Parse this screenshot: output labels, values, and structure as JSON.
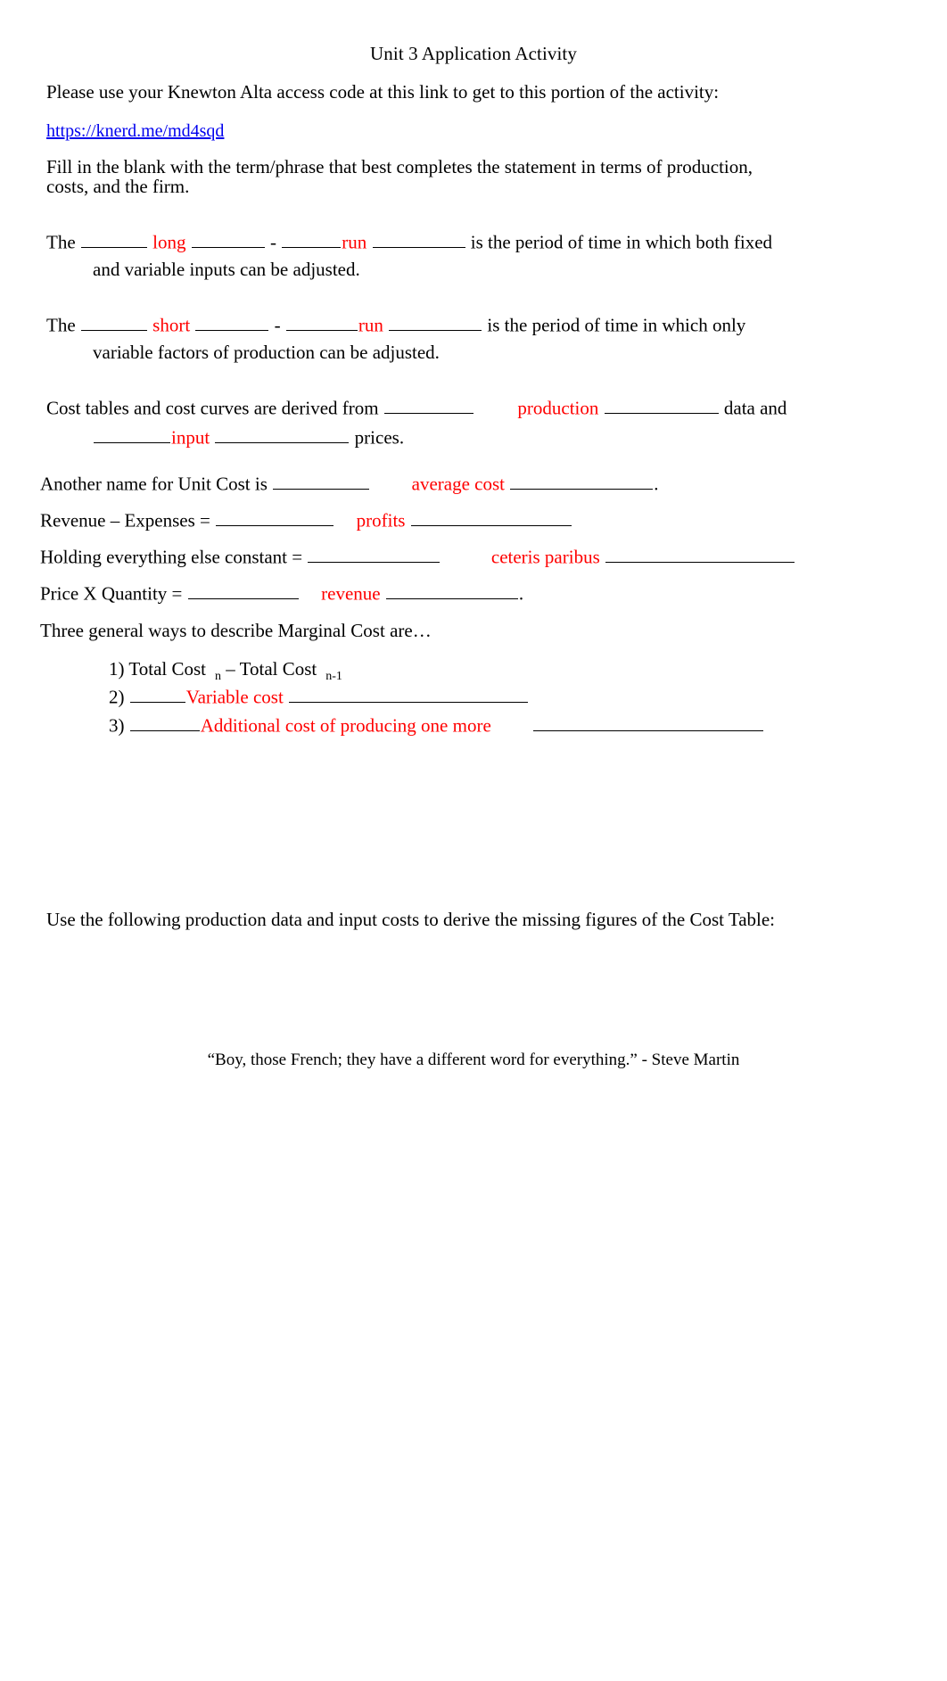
{
  "document": {
    "title": "Unit 3 Application Activity",
    "intro": "Please use your Knewton Alta access code at this link to get to this portion of the activity:",
    "link": "https://knerd.me/md4sqd",
    "instructions_line1": "Fill in the blank with the term/phrase that best completes the statement in terms of production,",
    "instructions_line2": "costs, and the firm."
  },
  "statements": {
    "long_run": {
      "lead": "The",
      "answer1": "long",
      "separator": "-",
      "answer2": "run",
      "tail": "is the period of time in which both fixed",
      "continuation": "and variable inputs can be adjusted."
    },
    "short_run": {
      "lead": "The",
      "answer1": "short",
      "separator": "-",
      "answer2": "run",
      "tail": "is the period of time in which only",
      "continuation": "variable factors of production can be adjusted."
    },
    "cost_tables": {
      "lead": "Cost tables and cost curves are derived from",
      "answer1": "production",
      "mid": "data and",
      "answer2": "input",
      "tail": "prices."
    },
    "unit_cost": {
      "lead": "Another name for Unit Cost is",
      "answer": "average cost",
      "tail": "."
    },
    "profits": {
      "lead": "Revenue – Expenses =",
      "answer": "profits"
    },
    "ceteris_paribus": {
      "lead": "Holding everything else constant =",
      "answer": "ceteris paribus"
    },
    "revenue": {
      "lead": "Price X Quantity =",
      "answer": "revenue",
      "tail": "."
    }
  },
  "marginal_cost": {
    "heading": "Three general ways to describe Marginal Cost are…",
    "items": [
      {
        "number": "1)",
        "text_a": "Total Cost",
        "sub_a": "n",
        "text_b": "– Total Cost",
        "sub_b": "n-1"
      },
      {
        "number": "2)",
        "answer": "Variable cost"
      },
      {
        "number": "3)",
        "answer": "Additional cost of producing one more"
      }
    ]
  },
  "cost_table_prompt": "Use the following production data and input costs to derive the missing figures of the Cost Table:",
  "footer_quote": "“Boy, those French; they have a different word for everything.” - Steve Martin",
  "colors": {
    "answer_red": "#ff0000",
    "link_blue": "#0000ee",
    "text_black": "#000000",
    "background": "#ffffff"
  }
}
